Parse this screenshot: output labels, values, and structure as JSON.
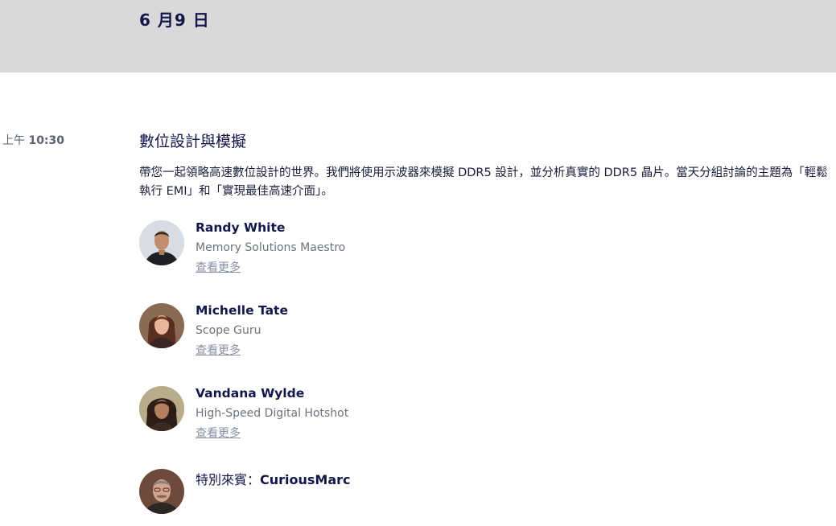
{
  "day_header": {
    "title": "6 月9 日"
  },
  "session": {
    "time_prefix": "上午 ",
    "time": "10:30",
    "title": "數位設計與模擬",
    "description": "帶您一起領略高速數位設計的世界。我們將使用示波器來模擬 DDR5 設計，並分析真實的 DDR5 晶片。當天分組討論的主題為「輕鬆執行 EMI」和「實現最佳高速介面」。"
  },
  "speakers": [
    {
      "name": "Randy White",
      "role": "Memory Solutions Maestro",
      "link_label": "查看更多"
    },
    {
      "name": "Michelle Tate",
      "role": "Scope Guru",
      "link_label": "查看更多"
    },
    {
      "name": "Vandana Wylde",
      "role": "High-Speed Digital Hotshot",
      "link_label": "查看更多"
    }
  ],
  "guest": {
    "prefix": "特別來賓：",
    "name": "CuriousMarc"
  }
}
